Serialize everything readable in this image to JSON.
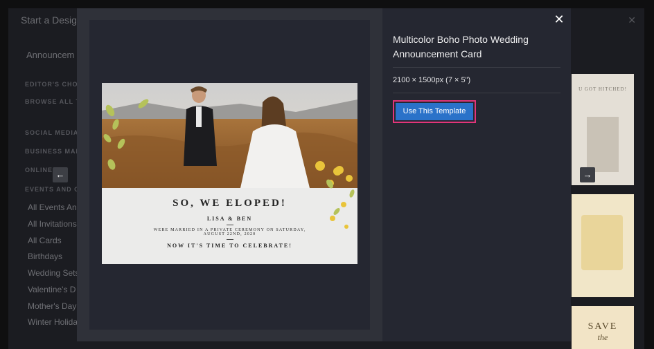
{
  "background": {
    "dialog_title": "Start a Desig",
    "search_label": "Announcem",
    "sections": [
      {
        "label": "EDITOR'S CHOI"
      },
      {
        "label": "BROWSE ALL T"
      },
      {
        "label": "SOCIAL MEDIA"
      },
      {
        "label": "BUSINESS MAR"
      },
      {
        "label": "ONLINE"
      },
      {
        "label": "EVENTS AND C"
      }
    ],
    "categories": [
      "All Events An",
      "All Invitations",
      "All Cards",
      "Birthdays",
      "Wedding Sets",
      "Valentine's D",
      "Mother's Day",
      "Winter Holida"
    ],
    "thumb_texts": {
      "hitched": "U GOT HITCHED!",
      "save": "SAVE",
      "the": "the"
    }
  },
  "modal": {
    "template_title": "Multicolor Boho Photo Wedding Announcement Card",
    "size_text": "2100 × 1500px (7 × 5\")",
    "use_button_label": "Use This Template",
    "close_glyph": "✕",
    "prev_glyph": "←",
    "next_glyph": "→"
  },
  "card": {
    "headline": "SO, WE ELOPED!",
    "names": "LISA & BEN",
    "line1": "WERE MARRIED IN A PRIVATE CEREMONY ON SATURDAY,",
    "line2": "AUGUST 22ND, 2020",
    "celebrate": "NOW IT'S TIME TO CELEBRATE!"
  },
  "colors": {
    "accent_button": "#2a72c9",
    "highlight_outline": "#e2357a",
    "modal_bg": "#252731"
  }
}
